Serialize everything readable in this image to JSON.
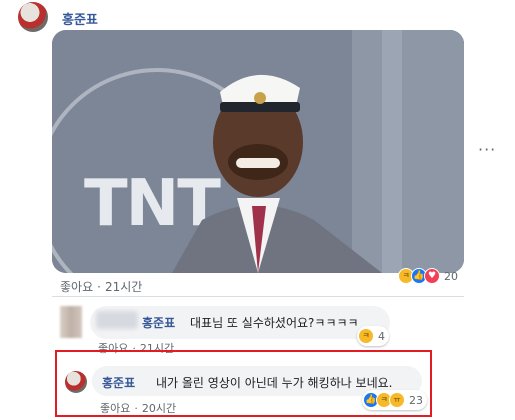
{
  "post": {
    "author": "홍준표",
    "like_label": "좋아요",
    "time": "21시간",
    "reaction_count": "20",
    "reactions": [
      "haha-icon",
      "like-icon",
      "love-icon"
    ],
    "media_logo": "TNT"
  },
  "comments": [
    {
      "author": "홍준표",
      "text": "대표님 또 실수하셨어요?ㅋㅋㅋㅋ",
      "like_label": "좋아요",
      "time": "21시간",
      "reaction_count": "4",
      "reactions": [
        "haha-icon"
      ]
    },
    {
      "author": "홍준표",
      "text": "내가 올린 영상이 아닌데 누가 해킹하나 보네요.",
      "like_label": "좋아요",
      "time": "20시간",
      "reaction_count": "23",
      "reactions": [
        "like-icon",
        "haha-icon",
        "sad-icon"
      ]
    }
  ],
  "colors": {
    "name_link": "#385898",
    "highlight_border": "#e31b23",
    "bubble_bg": "#f2f3f5"
  }
}
